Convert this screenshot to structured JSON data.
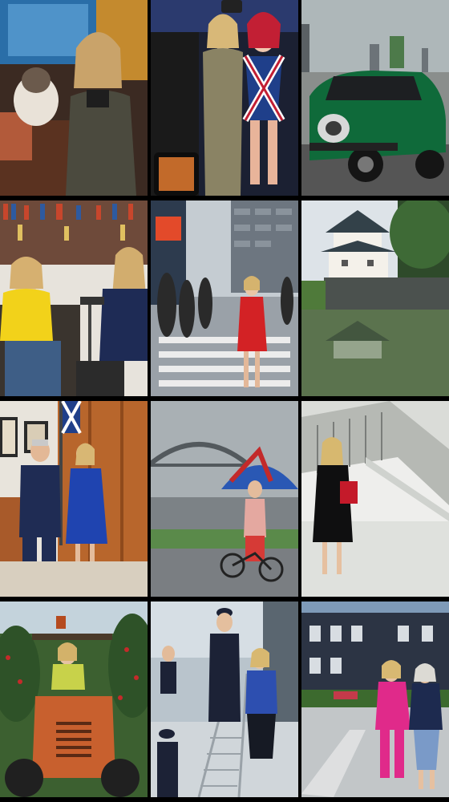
{
  "layout": "photo-grid",
  "columns": 3,
  "rows": 4,
  "tiles": [
    {
      "subject": "woman-with-cat-at-bookshelf"
    },
    {
      "subject": "selfie-with-union-jack-figure"
    },
    {
      "subject": "green-mini-car-city"
    },
    {
      "subject": "podcast-interview-library"
    },
    {
      "subject": "woman-in-red-dress-crosswalk"
    },
    {
      "subject": "japanese-castle-moat"
    },
    {
      "subject": "two-people-office-flag"
    },
    {
      "subject": "cyclist-umbrella-harbour-bridge"
    },
    {
      "subject": "woman-with-red-folder-stairs"
    },
    {
      "subject": "woman-on-tractor-orchard"
    },
    {
      "subject": "woman-with-naval-officer-ship"
    },
    {
      "subject": "two-women-in-pink-street"
    }
  ]
}
